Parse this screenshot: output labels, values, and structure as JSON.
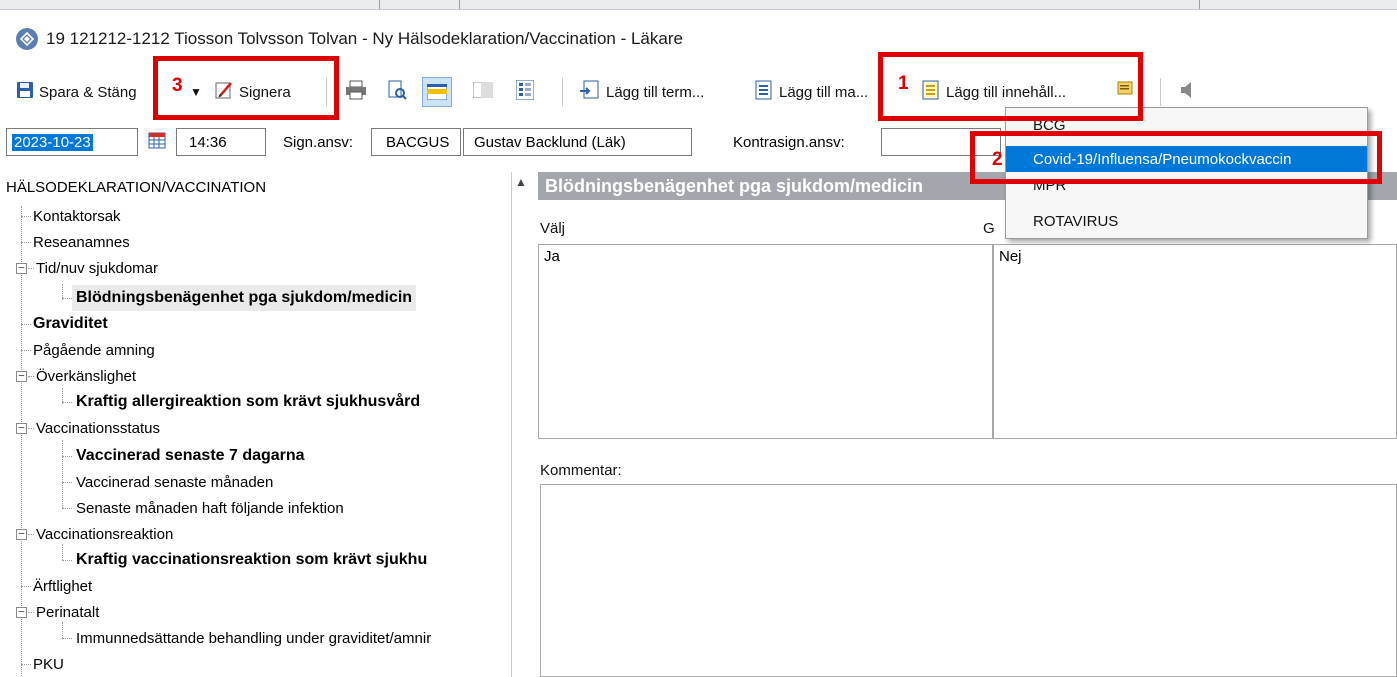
{
  "window": {
    "title": "19 121212-1212 Tiosson Tolvsson Tolvan - Ny Hälsodeklaration/Vaccination - Läkare"
  },
  "toolbar": {
    "save_close": "Spara & Stäng",
    "sign": "Signera",
    "add_term": "Lägg till term...",
    "add_template": "Lägg till ma...",
    "add_content": "Lägg till innehåll..."
  },
  "fields": {
    "date": "2023-10-23",
    "time": "14:36",
    "sign_resp_label": "Sign.ansv:",
    "sign_resp_code": "BACGUS",
    "sign_resp_name": "Gustav Backlund (Läk)",
    "countersign_label": "Kontrasign.ansv:",
    "countersign_value": ""
  },
  "tree": {
    "root": "HÄLSODEKLARATION/VACCINATION",
    "items": [
      {
        "label": "Kontaktorsak"
      },
      {
        "label": "Reseanamnes"
      },
      {
        "label": "Tid/nuv sjukdomar"
      },
      {
        "label": "Blödningsbenägenhet pga sjukdom/medicin"
      },
      {
        "label": "Graviditet"
      },
      {
        "label": "Pågående amning"
      },
      {
        "label": "Överkänslighet"
      },
      {
        "label": "Kraftig allergireaktion som krävt sjukhusvård"
      },
      {
        "label": "Vaccinationsstatus"
      },
      {
        "label": "Vaccinerad senaste 7 dagarna"
      },
      {
        "label": "Vaccinerad senaste månaden"
      },
      {
        "label": "Senaste månaden haft följande infektion"
      },
      {
        "label": "Vaccinationsreaktion"
      },
      {
        "label": "Kraftig vaccinationsreaktion som krävt sjukhu"
      },
      {
        "label": "Ärftlighet"
      },
      {
        "label": "Perinatalt"
      },
      {
        "label": "Immunnedsättande behandling under graviditet/amnir"
      },
      {
        "label": "PKU"
      }
    ]
  },
  "detail": {
    "header": "Blödningsbenägenhet pga sjukdom/medicin",
    "choose_label": "Välj",
    "choose_value": "Ja",
    "right_label": "G",
    "right_value": "Nej",
    "comment_label": "Kommentar:"
  },
  "dropdown": {
    "items": [
      "BCG",
      "Covid-19/Influensa/Pneumokockvaccin",
      "MPR",
      "ROTAVIRUS"
    ],
    "active_index": 1
  },
  "annotations": {
    "callout_1": "1",
    "callout_2": "2",
    "callout_3": "3",
    "color": "#e10000"
  },
  "colors": {
    "selection": "#0078d7",
    "header_bar": "#a3a7ad"
  }
}
